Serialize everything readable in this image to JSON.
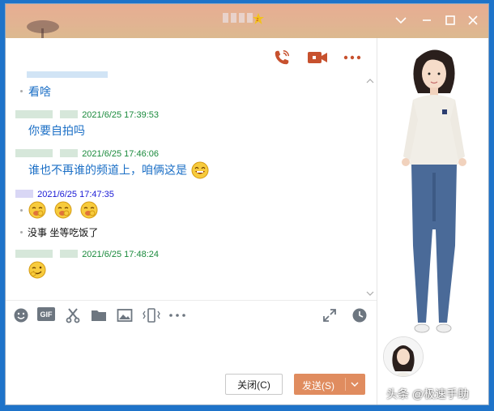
{
  "colors": {
    "accent": "#e08c5f",
    "timestamp": "#1a8a3c",
    "message": "#1b6fc6",
    "timestamp_self": "#1a1ad6"
  },
  "header": {
    "window_controls": [
      "chevron-down-icon",
      "minimize-icon",
      "maximize-icon",
      "close-icon"
    ],
    "actions": [
      "phone-icon",
      "video-call-icon",
      "more-icon"
    ]
  },
  "messages": [
    {
      "type": "text",
      "text": "看啥"
    },
    {
      "type": "meta",
      "timestamp": "2021/6/25 17:39:53"
    },
    {
      "type": "text",
      "text": "你要自拍吗"
    },
    {
      "type": "meta",
      "timestamp": "2021/6/25 17:46:06"
    },
    {
      "type": "text",
      "text": "谁也不再谁的频道上，咱俩这是"
    },
    {
      "type": "meta",
      "timestamp": "2021/6/25 17:47:35"
    },
    {
      "type": "emoji",
      "icons": [
        "laugh-emoji-icon",
        "laugh-emoji-icon",
        "laugh-emoji-icon"
      ]
    },
    {
      "type": "text",
      "text": "没事 坐等吃饭了"
    },
    {
      "type": "meta",
      "timestamp": "2021/6/25 17:48:24"
    },
    {
      "type": "emoji",
      "icons": [
        "grin-emoji-icon"
      ]
    }
  ],
  "toolbar": {
    "left": [
      "emoji-icon",
      "gif-icon",
      "scissors-icon",
      "folder-icon",
      "image-icon",
      "shake-icon",
      "more-icon"
    ],
    "right": [
      "expand-icon",
      "history-icon"
    ],
    "gif_label": "GIF"
  },
  "buttons": {
    "close": "关闭(C)",
    "send": "发送(S)"
  },
  "watermark": "头条 @极速手助"
}
